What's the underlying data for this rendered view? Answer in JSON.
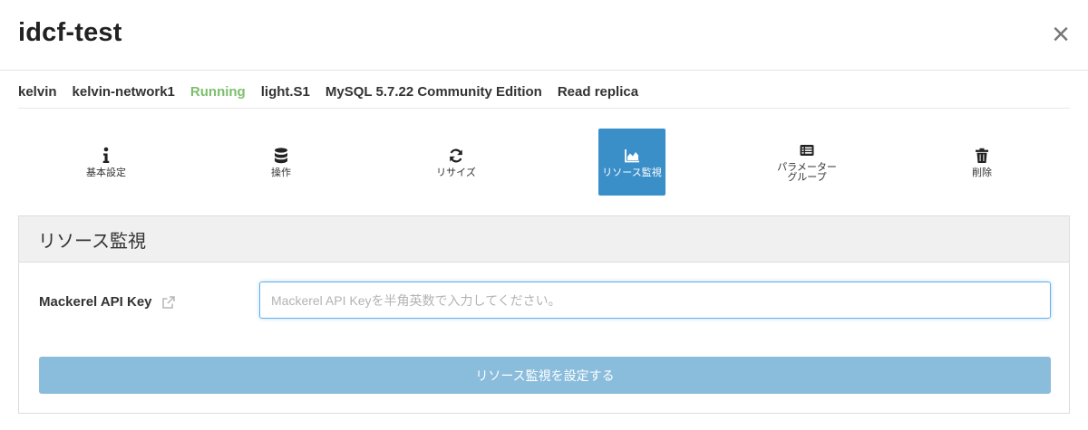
{
  "modal": {
    "title": "idcf-test",
    "close_symbol": "×"
  },
  "info": {
    "user": "kelvin",
    "network": "kelvin-network1",
    "status": "Running",
    "status_color": "#7cbf6c",
    "plan": "light.S1",
    "engine": "MySQL 5.7.22 Community Edition",
    "role": "Read replica"
  },
  "menu": {
    "active_color": "#3a8fc9",
    "items": [
      {
        "label": "基本設定",
        "icon": "info-icon"
      },
      {
        "label": "操作",
        "icon": "database-icon"
      },
      {
        "label": "リサイズ",
        "icon": "refresh-icon"
      },
      {
        "label": "リソース監視",
        "icon": "area-chart-icon",
        "active": true
      },
      {
        "label": "パラメーター\nグループ",
        "icon": "list-icon"
      },
      {
        "label": "削除",
        "icon": "trash-icon"
      }
    ]
  },
  "resource_monitor": {
    "heading": "リソース監視",
    "field_label": "Mackerel API Key",
    "input_placeholder": "Mackerel API Keyを半角英数で入力してください。",
    "input_value": "",
    "submit_label": "リソース監視を設定する",
    "submit_color": "#8abcdc"
  }
}
